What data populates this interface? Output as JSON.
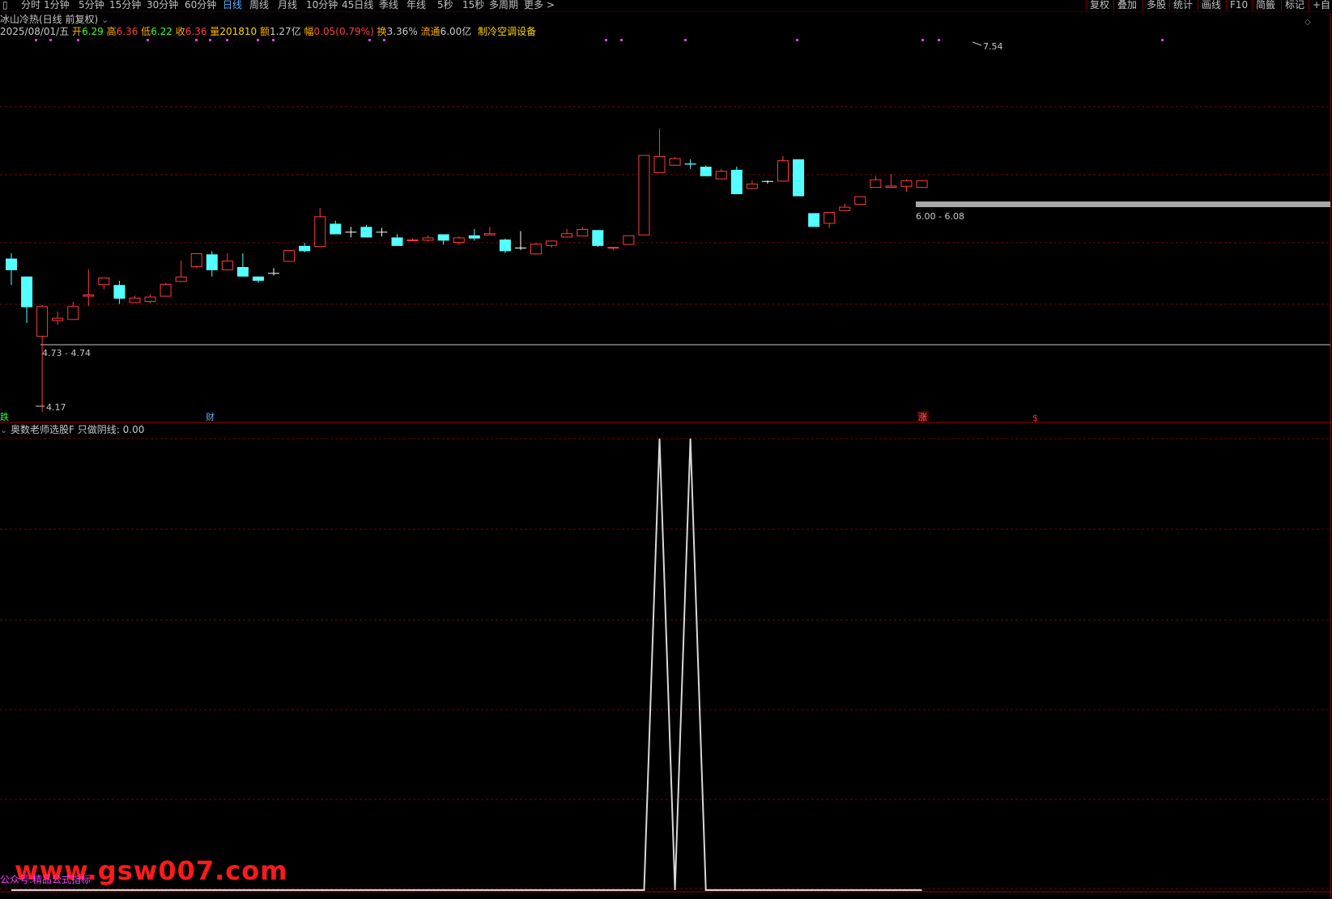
{
  "toolbar": {
    "items": [
      "分时",
      "1分钟",
      "5分钟",
      "15分钟",
      "30分钟",
      "60分钟",
      "日线",
      "周线",
      "月线",
      "10分钟",
      "45日线",
      "季线",
      "年线",
      "5秒",
      "15秒",
      "多周期",
      "更多 >"
    ],
    "active": "日线",
    "right": [
      "复权",
      "叠加",
      "多股",
      "统计",
      "画线",
      "F10",
      "简籤",
      "标记",
      "+自"
    ]
  },
  "header": {
    "title": "冰山冷热(日线 前复权)",
    "date": "2025/08/01/五",
    "open_label": "开",
    "open": "6.29",
    "high_label": "高",
    "high": "6.36",
    "low_label": "低",
    "low": "6.22",
    "close_label": "收",
    "close": "6.36",
    "vol_label": "量",
    "vol": "201810",
    "amt_label": "额",
    "amt": "1.27亿",
    "chg_label": "幅",
    "chg": "0.05(0.79%)",
    "turn_label": "换",
    "turn": "3.36%",
    "float_label": "流通",
    "float": "6.00亿",
    "industry": "制冷空调设备"
  },
  "colors": {
    "up": "#ff3b3b",
    "down": "#54ffff",
    "grid": "#7a0000",
    "text": "#c8c8c8",
    "cross": "#ffffff"
  },
  "annotations": {
    "high_label": "7.54",
    "low_label": "4.17",
    "range1": "4.73 - 4.74",
    "range2": "6.00 - 6.08",
    "marker_die": "跌",
    "marker_cai": "财",
    "marker_zhang": "涨",
    "marker_dollar": "$"
  },
  "indicator": {
    "title": "奥数老师选股F",
    "line_name": "只做阴线",
    "value": "0.00"
  },
  "watermark": {
    "text": "www.gsw007.com",
    "small": "公众号:精品公式指标"
  },
  "chart_data": {
    "type": "candlestick",
    "ylim": [
      4.1,
      7.7
    ],
    "candles": [
      [
        5.62,
        5.51,
        5.67,
        5.37
      ],
      [
        5.45,
        5.16,
        5.45,
        5.01
      ],
      [
        4.88,
        5.17,
        5.18,
        4.17
      ],
      [
        5.03,
        5.06,
        5.12,
        4.99
      ],
      [
        5.04,
        5.17,
        5.21,
        5.04
      ],
      [
        5.26,
        5.28,
        5.52,
        5.17
      ],
      [
        5.37,
        5.44,
        5.44,
        5.33
      ],
      [
        5.37,
        5.24,
        5.41,
        5.19
      ],
      [
        5.2,
        5.25,
        5.27,
        5.2
      ],
      [
        5.21,
        5.26,
        5.28,
        5.2
      ],
      [
        5.26,
        5.38,
        5.39,
        5.26
      ],
      [
        5.4,
        5.45,
        5.6,
        5.4
      ],
      [
        5.54,
        5.67,
        5.67,
        5.53
      ],
      [
        5.66,
        5.51,
        5.69,
        5.45
      ],
      [
        5.51,
        5.6,
        5.67,
        5.51
      ],
      [
        5.54,
        5.45,
        5.67,
        5.45
      ],
      [
        5.45,
        5.41,
        5.45,
        5.39
      ],
      [
        5.48,
        5.48,
        5.53,
        5.46
      ],
      [
        5.59,
        5.7,
        5.7,
        5.59
      ],
      [
        5.74,
        5.69,
        5.77,
        5.68
      ],
      [
        5.73,
        6.02,
        6.1,
        5.73
      ],
      [
        5.95,
        5.85,
        5.98,
        5.85
      ],
      [
        5.87,
        5.87,
        5.92,
        5.82
      ],
      [
        5.92,
        5.82,
        5.94,
        5.82
      ],
      [
        5.87,
        5.87,
        5.91,
        5.83
      ],
      [
        5.82,
        5.74,
        5.85,
        5.74
      ],
      [
        5.79,
        5.8,
        5.81,
        5.79
      ],
      [
        5.79,
        5.82,
        5.84,
        5.78
      ],
      [
        5.85,
        5.79,
        5.85,
        5.75
      ],
      [
        5.77,
        5.82,
        5.83,
        5.75
      ],
      [
        5.84,
        5.81,
        5.9,
        5.79
      ],
      [
        5.84,
        5.86,
        5.92,
        5.84
      ],
      [
        5.8,
        5.69,
        5.81,
        5.67
      ],
      [
        5.72,
        5.72,
        5.88,
        5.7
      ],
      [
        5.66,
        5.76,
        5.77,
        5.66
      ],
      [
        5.74,
        5.79,
        5.79,
        5.72
      ],
      [
        5.82,
        5.86,
        5.9,
        5.82
      ],
      [
        5.83,
        5.9,
        5.92,
        5.83
      ],
      [
        5.89,
        5.74,
        5.89,
        5.73
      ],
      [
        5.72,
        5.73,
        5.73,
        5.7
      ],
      [
        5.75,
        5.84,
        5.84,
        5.75
      ],
      [
        5.84,
        6.6,
        6.6,
        5.84
      ],
      [
        6.43,
        6.59,
        6.85,
        6.43
      ],
      [
        6.5,
        6.57,
        6.58,
        6.5
      ],
      [
        6.52,
        6.51,
        6.56,
        6.47
      ],
      [
        6.49,
        6.4,
        6.5,
        6.4
      ],
      [
        6.37,
        6.45,
        6.47,
        6.37
      ],
      [
        6.46,
        6.23,
        6.49,
        6.23
      ],
      [
        6.28,
        6.33,
        6.36,
        6.28
      ],
      [
        6.35,
        6.35,
        6.36,
        6.33
      ],
      [
        6.35,
        6.55,
        6.59,
        6.35
      ],
      [
        6.56,
        6.21,
        6.56,
        6.21
      ],
      [
        6.05,
        5.92,
        6.05,
        5.92
      ],
      [
        5.95,
        6.06,
        6.06,
        5.91
      ],
      [
        6.07,
        6.11,
        6.14,
        6.07
      ],
      [
        6.13,
        6.21,
        6.21,
        6.13
      ],
      [
        6.29,
        6.37,
        6.4,
        6.29
      ],
      [
        6.29,
        6.31,
        6.42,
        6.29
      ],
      [
        6.3,
        6.36,
        6.37,
        6.25
      ],
      [
        6.29,
        6.36,
        6.36,
        6.29
      ]
    ],
    "indicator_values": [
      0,
      0,
      0,
      0,
      0,
      0,
      0,
      0,
      0,
      0,
      0,
      0,
      0,
      0,
      0,
      0,
      0,
      0,
      0,
      0,
      0,
      0,
      0,
      0,
      0,
      0,
      0,
      0,
      0,
      0,
      0,
      0,
      0,
      0,
      0,
      0,
      0,
      0,
      0,
      0,
      0,
      0,
      1,
      0,
      1,
      0,
      0,
      0,
      0,
      0,
      0,
      0,
      0,
      0,
      0,
      0,
      0,
      0,
      0,
      0
    ]
  }
}
